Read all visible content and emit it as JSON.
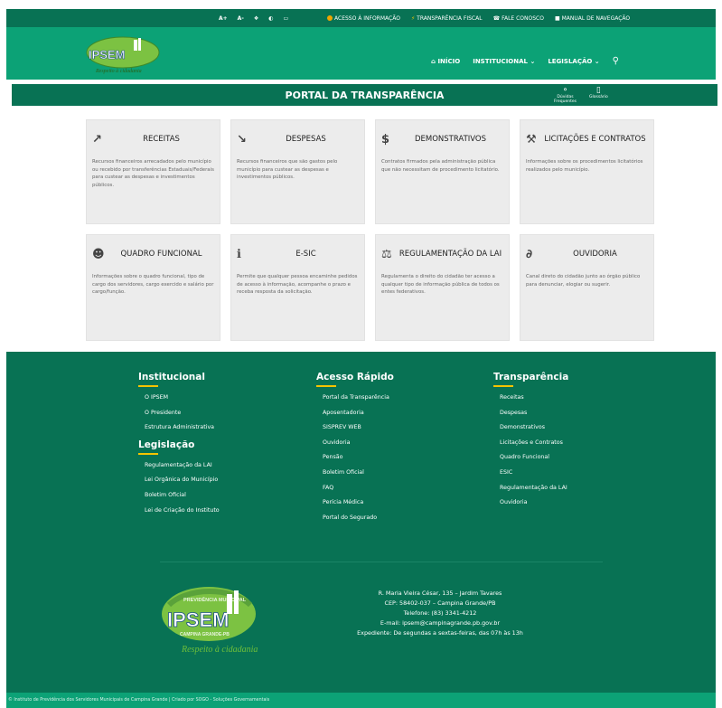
{
  "topbar": {
    "accessibility": [
      "A+",
      "A-",
      "❖",
      "◐",
      "▭"
    ],
    "links": [
      {
        "label": "ACESSO À INFORMAÇÃO",
        "icon": "info-icon"
      },
      {
        "label": "TRANSPARÊNCIA FISCAL",
        "icon": "bolt-icon"
      },
      {
        "label": "FALE CONOSCO",
        "icon": "phone-icon"
      },
      {
        "label": "MANUAL DE NAVEGAÇÃO",
        "icon": "book-icon"
      }
    ]
  },
  "logo": {
    "name": "IPSEM",
    "motto": "Respeito à cidadania",
    "ring": "PREVIDÊNCIA MUNICIPAL",
    "city": "CAMPINA GRANDE-PB"
  },
  "nav": {
    "home": "INÍCIO",
    "institucional": "INSTITUCIONAL",
    "legislacao": "LEGISLAÇÃO"
  },
  "portal": {
    "title": "PORTAL DA TRANSPARÊNCIA",
    "faq_line1": "Dúvidas",
    "faq_line2": "Frequentes",
    "glossary": "Glossário"
  },
  "cards": [
    {
      "icon": "chart-up-icon",
      "glyph": "↗",
      "title": "RECEITAS",
      "desc": "Recursos financeiros arrecadados pelo município ou recebido por transferências Estaduais/Federais para custear as despesas e investimentos públicos."
    },
    {
      "icon": "chart-down-icon",
      "glyph": "↘",
      "title": "DESPESAS",
      "desc": "Recursos financeiros que são gastos pelo município para custear as despesas e investimentos públicos."
    },
    {
      "icon": "dollar-icon",
      "glyph": "$",
      "title": "DEMONSTRATIVOS",
      "desc": "Contratos firmados pela administração pública que não necessitam de procedimento licitatório."
    },
    {
      "icon": "gavel-icon",
      "glyph": "⚒",
      "title": "LICITAÇÕES E CONTRATOS",
      "desc": "Informações sobre os procedimentos licitatórios realizados pelo município."
    },
    {
      "icon": "users-icon",
      "glyph": "☻",
      "title": "QUADRO FUNCIONAL",
      "desc": "Informações sobre o quadro funcional, tipo de cargo dos servidores, cargo exercido e salário por cargo/função."
    },
    {
      "icon": "info-circle-icon",
      "glyph": "ℹ",
      "title": "E-SIC",
      "desc": "Permite que qualquer pessoa encaminhe pedidos de acesso à informação, acompanhe o prazo e receba resposta da solicitação."
    },
    {
      "icon": "balance-scale-icon",
      "glyph": "⚖",
      "title": "REGULAMENTAÇÃO DA LAI",
      "desc": "Regulamenta o direito do cidadão ter acesso a qualquer tipo de informação pública de todos os entes federativos."
    },
    {
      "icon": "ear-icon",
      "glyph": "∂",
      "title": "OUVIDORIA",
      "desc": "Canal direto do cidadão junto ao órgão público para denunciar, elogiar ou sugerir."
    }
  ],
  "footer": {
    "institucional": {
      "title": "Institucional",
      "links": [
        "O IPSEM",
        "O Presidente",
        "Estrutura Administrativa"
      ]
    },
    "legislacao": {
      "title": "Legislação",
      "links": [
        "Regulamentação da LAI",
        "Lei Orgânica do Município",
        "Boletim Oficial",
        "Lei de Criação do Instituto"
      ]
    },
    "acesso": {
      "title": "Acesso Rápido",
      "links": [
        "Portal da Transparência",
        "Aposentadoria",
        "SISPREV WEB",
        "Ouvidoria",
        "Pensão",
        "Boletim Oficial",
        "FAQ",
        "Perícia Médica",
        "Portal do Segurado"
      ]
    },
    "transparencia": {
      "title": "Transparência",
      "links": [
        "Receitas",
        "Despesas",
        "Demonstrativos",
        "Licitações e Contratos",
        "Quadro Funcional",
        "ESIC",
        "Regulamentação da LAI",
        "Ouvidoria"
      ]
    },
    "address": [
      "R. Maria Vieira César, 135 – Jardim Tavares",
      "CEP: 58402-037 – Campina Grande/PB",
      "Telefone: (83) 3341-4212",
      "E-mail: ipsem@campinagrande.pb.gov.br",
      "Expediente: De segundas a sextas-feiras, das 07h às 13h"
    ],
    "copyright": "© Instituto de Previdência dos Servidores Municipais de Campina Grande | Criado por SOGO - Soluções Governamentais"
  },
  "colors": {
    "primary": "#087254",
    "accent": "#0ca276",
    "highlight": "#f5c400",
    "card": "#ececec"
  }
}
